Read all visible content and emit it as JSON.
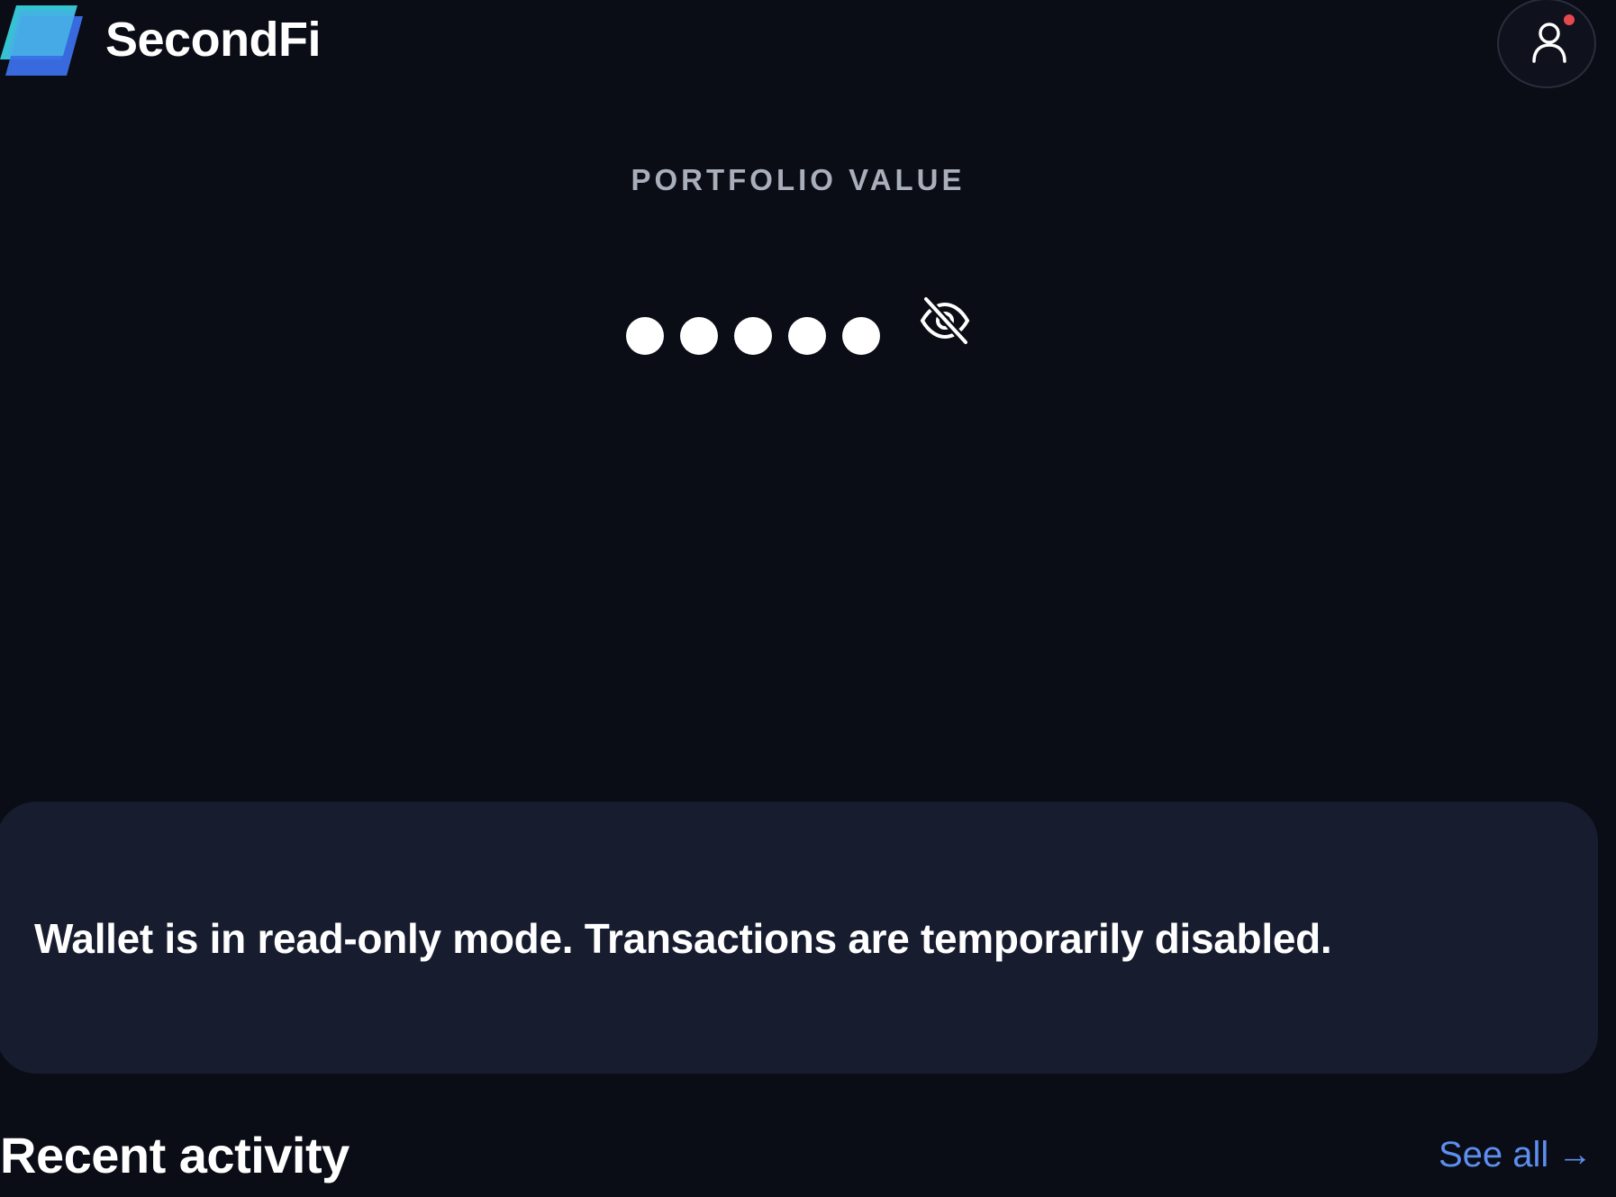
{
  "header": {
    "brand": "SecondFi",
    "logo_icon": "logo-icon",
    "profile_icon": "user-icon",
    "notification_color": "#e5484d"
  },
  "portfolio": {
    "label": "PORTFOLIO VALUE",
    "masked_value": "●●●●●",
    "visibility_icon": "eye-off-icon"
  },
  "banner": {
    "message": "Wallet is in read-only mode. Transactions are temporarily disabled."
  },
  "recent_activity": {
    "title": "Recent activity",
    "see_all_label": "See all",
    "see_all_arrow": "→",
    "link_color": "#5d8fef"
  },
  "colors": {
    "background": "#0a0c16",
    "banner_background": "#171c2f",
    "logo_front": "#3b8ff0",
    "logo_back": "#35c3d1"
  }
}
